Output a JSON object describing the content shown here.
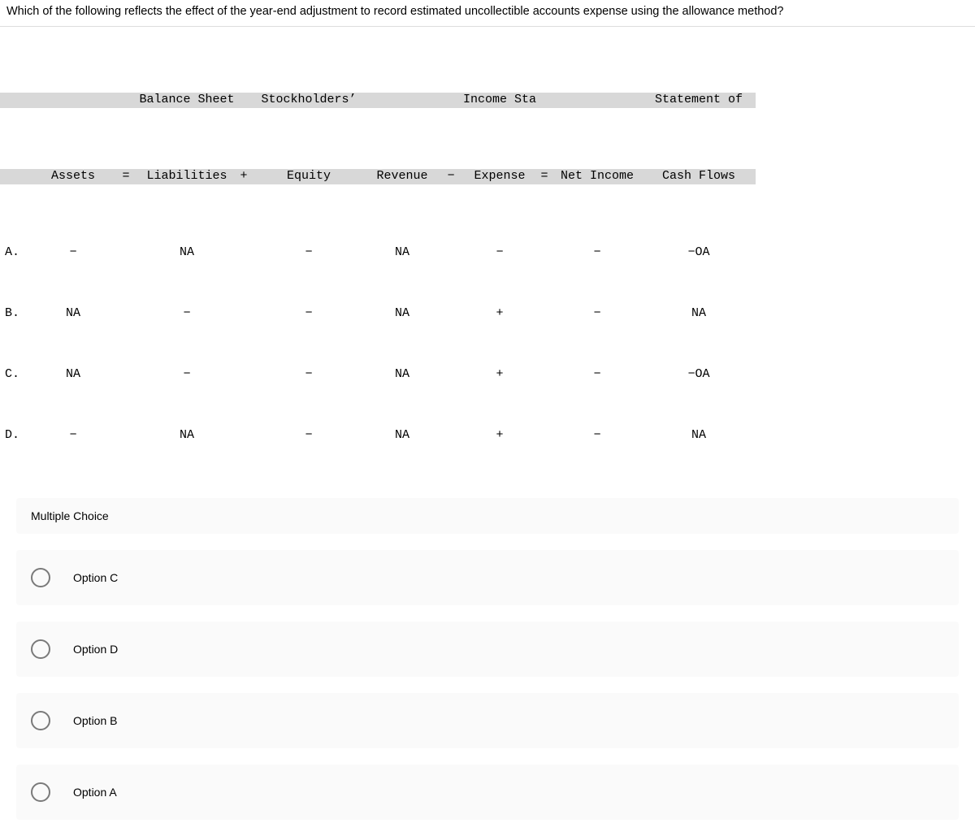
{
  "question": "Which of the following reflects the effect of the year-end adjustment to record estimated uncollectible accounts expense using the allowance method?",
  "section_headers": {
    "balance_sheet": "Balance Sheet",
    "income_statement": "Income Statement"
  },
  "col_headers": {
    "assets": "Assets",
    "eq": "=",
    "liabilities": "Liabilities",
    "plus": "+",
    "equity": "Stockholders’\nEquity",
    "equity_line1": "Stockholders’",
    "equity_line2": "Equity",
    "revenue": "Revenue",
    "minus": "−",
    "expense": "Expense",
    "eq2": "=",
    "net_income": "Net Income",
    "cash_flows_line1": "Statement of",
    "cash_flows_line2": "Cash Flows"
  },
  "rows": [
    {
      "label": "A.",
      "assets": "−",
      "liab": "NA",
      "equity": "−",
      "rev": "NA",
      "exp": "−",
      "ni": "−",
      "cf": "−OA"
    },
    {
      "label": "B.",
      "assets": "NA",
      "liab": "−",
      "equity": "−",
      "rev": "NA",
      "exp": "+",
      "ni": "−",
      "cf": "NA"
    },
    {
      "label": "C.",
      "assets": "NA",
      "liab": "−",
      "equity": "−",
      "rev": "NA",
      "exp": "+",
      "ni": "−",
      "cf": "−OA"
    },
    {
      "label": "D.",
      "assets": "−",
      "liab": "NA",
      "equity": "−",
      "rev": "NA",
      "exp": "+",
      "ni": "−",
      "cf": "NA"
    }
  ],
  "mc_title": "Multiple Choice",
  "options": [
    "Option C",
    "Option D",
    "Option B",
    "Option A"
  ],
  "chart_data": {
    "type": "table",
    "section_headers": [
      "Balance Sheet",
      "Income Statement",
      "Statement of Cash Flows"
    ],
    "columns": [
      "Assets",
      "=",
      "Liabilities",
      "+",
      "Stockholders’ Equity",
      "Revenue",
      "−",
      "Expense",
      "=",
      "Net Income",
      "Statement of Cash Flows"
    ],
    "rows": {
      "A": [
        "−",
        "=",
        "NA",
        "+",
        "−",
        "NA",
        "−",
        "−",
        "=",
        "−",
        "−OA"
      ],
      "B": [
        "NA",
        "=",
        "−",
        "+",
        "−",
        "NA",
        "−",
        "+",
        "=",
        "−",
        "NA"
      ],
      "C": [
        "NA",
        "=",
        "−",
        "+",
        "−",
        "NA",
        "−",
        "+",
        "=",
        "−",
        "−OA"
      ],
      "D": [
        "−",
        "=",
        "NA",
        "+",
        "−",
        "NA",
        "−",
        "+",
        "=",
        "−",
        "NA"
      ]
    }
  }
}
